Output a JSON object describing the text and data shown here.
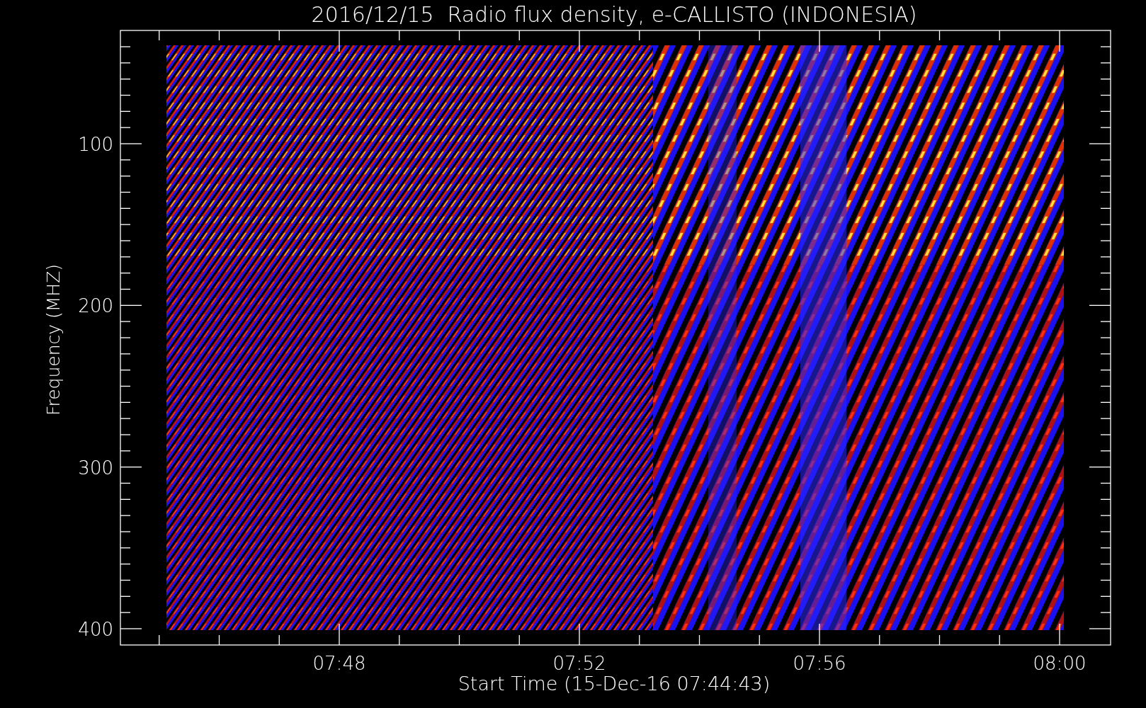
{
  "title": "2016/12/15  Radio flux density, e-CALLISTO (INDONESIA)",
  "plot": {
    "ylabel": "Frequency (MHZ)",
    "xlabel": "Start Time (15-Dec-16 07:44:43)",
    "y_tick_labels": [
      "100",
      "200",
      "300",
      "400"
    ],
    "x_tick_labels": [
      "07:48",
      "07:52",
      "07:56",
      "08:00"
    ]
  }
}
